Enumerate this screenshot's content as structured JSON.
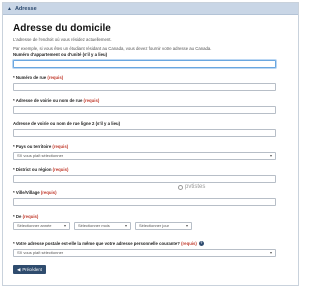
{
  "panel": {
    "header": "Adresse"
  },
  "page": {
    "title": "Adresse du domicile",
    "intro1": "L'adresse de l'endroit où vous résidez actuellement.",
    "intro2": "Par exemple, si vous êtes un étudiant résidant au Canada, vous devez fournir votre adresse au Canada."
  },
  "fields": {
    "apartment": {
      "label": "Numéro d'appartement ou d'unité (s'il y a lieu)"
    },
    "street_number": {
      "label": "Numéro de rue",
      "req": "(requis)"
    },
    "street_line1": {
      "label": "Adresse de voirie ou nom de rue",
      "req": "(requis)"
    },
    "street_line2": {
      "label": "Adresse de voirie ou nom de rue ligne 2 (s'il y a lieu)"
    },
    "country": {
      "label": "Pays ou territoire",
      "req": "(requis)",
      "value": "S'il vous plaît sélectionner"
    },
    "district": {
      "label": "District ou région",
      "req": "(requis)"
    },
    "city": {
      "label": "Ville/Village",
      "req": "(requis)"
    },
    "dob": {
      "label": "De",
      "req": "(requis)",
      "year": "Sélectionner année",
      "month": "Sélectionner mois",
      "day": "Sélectionner jour"
    },
    "mailing_same": {
      "label": "Votre adresse postale est-elle la même que votre adresse personnelle courante?",
      "req": "(requis)",
      "value": "S'il vous plaît sélectionner"
    }
  },
  "buttons": {
    "previous": "Précédent"
  },
  "watermark": {
    "text": "pvtistes"
  }
}
